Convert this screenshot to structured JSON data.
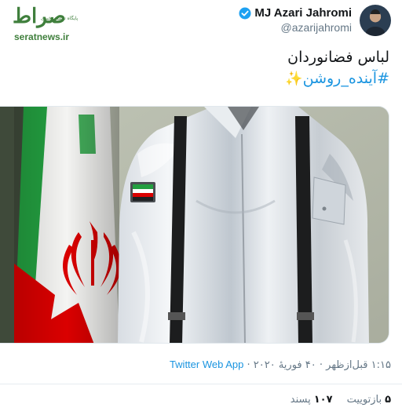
{
  "watermark": {
    "logo_text": "صراط",
    "tagline": "پایگاه تحلیلی خبری",
    "url": "seratnews.ir"
  },
  "user": {
    "display_name": "MJ Azari Jahromi",
    "handle": "@azarijahromi",
    "verified": true
  },
  "tweet": {
    "line1": "لباس فضانوردان",
    "hashtag": "#آینده_روشن",
    "emoji": "✨"
  },
  "meta": {
    "time": "۱:۱۵ قبل‌ازظهر",
    "separator": " · ",
    "date": "۴۰ فوریهٔ ۲۰۲۰",
    "source": "Twitter Web App"
  },
  "stats": {
    "retweets_count": "۵",
    "retweets_label": "بازتوییت",
    "likes_count": "۱۰۷",
    "likes_label": "پسند"
  },
  "colors": {
    "link": "#1b95e0",
    "secondary_text": "#657786",
    "flag_green": "#239f40",
    "flag_red": "#da0000"
  },
  "icons": {
    "verified": "verified-badge-icon",
    "sparkle": "sparkles-emoji"
  }
}
